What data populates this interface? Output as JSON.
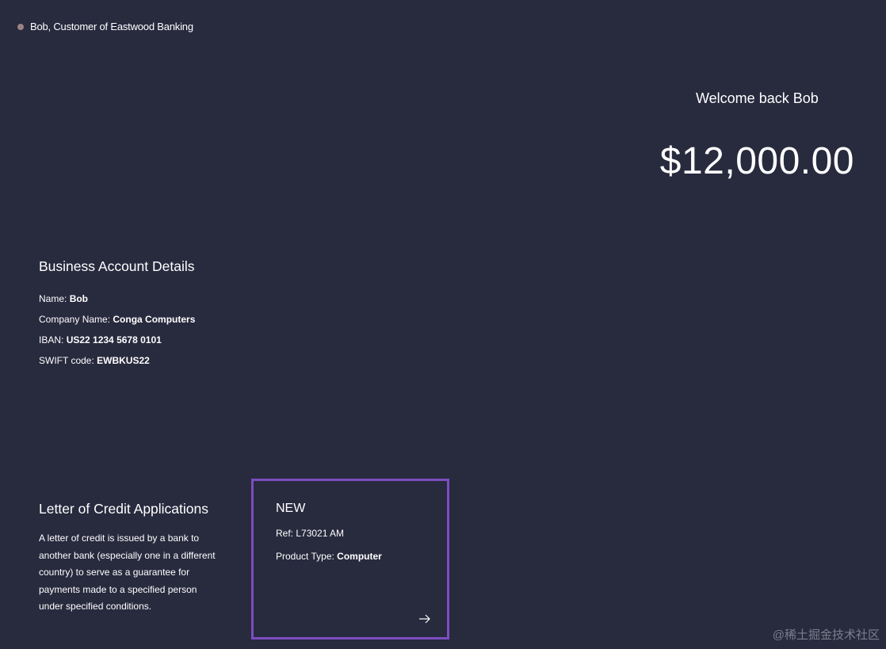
{
  "header": {
    "user_label": "Bob, Customer of Eastwood Banking"
  },
  "welcome": {
    "greeting": "Welcome back Bob",
    "balance": "$12,000.00"
  },
  "account": {
    "title": "Business Account Details",
    "rows": [
      {
        "label": "Name: ",
        "value": "Bob"
      },
      {
        "label": "Company Name: ",
        "value": "Conga Computers"
      },
      {
        "label": "IBAN: ",
        "value": "US22 1234 5678 0101"
      },
      {
        "label": "SWIFT code: ",
        "value": "EWBKUS22"
      }
    ]
  },
  "letter_of_credit": {
    "title": "Letter of Credit Applications",
    "description": "A letter of credit is issued by a bank to another bank (especially one in a different country) to serve as a guarantee for payments made to a specified person under specified conditions."
  },
  "application": {
    "status": "NEW",
    "ref": "Ref: L73021 AM",
    "product_label": "Product Type: ",
    "product_value": "Computer"
  },
  "watermark": "@稀土掘金技术社区",
  "colors": {
    "background": "#282a3e",
    "card_border": "#7c4dc2",
    "status_dot": "#9a8482"
  },
  "icons": {
    "status": "status-dot-icon",
    "card_action": "arrow-right-icon"
  }
}
